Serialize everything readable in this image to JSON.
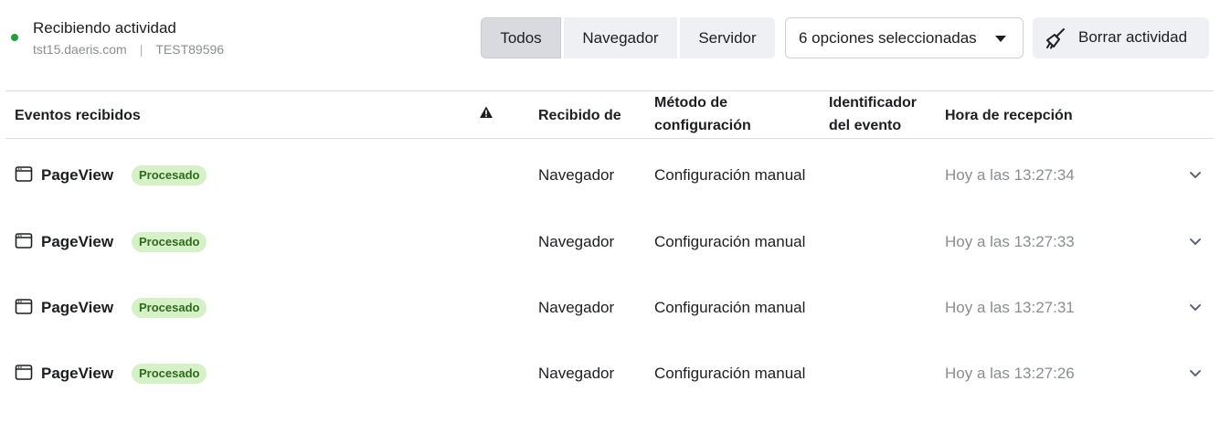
{
  "status": {
    "title": "Recibiendo actividad",
    "domain": "tst15.daeris.com",
    "separator": "|",
    "code": "TEST89596",
    "dot_color": "#22a03b"
  },
  "filters": {
    "segments": [
      {
        "label": "Todos",
        "selected": true
      },
      {
        "label": "Navegador",
        "selected": false
      },
      {
        "label": "Servidor",
        "selected": false
      }
    ],
    "options_dropdown": "6 opciones seleccionadas",
    "clear_button": "Borrar actividad"
  },
  "table": {
    "headers": {
      "events": "Eventos recibidos",
      "received_from": "Recibido de",
      "method_line1": "Método de",
      "method_line2": "configuración",
      "event_id_line1": "Identificador",
      "event_id_line2": "del evento",
      "received_time": "Hora de recepción"
    },
    "warning_icon": "warning-triangle-icon",
    "badge_color": "#d6f0c7",
    "rows": [
      {
        "event": "PageView",
        "status": "Procesado",
        "source": "Navegador",
        "method": "Configuración manual",
        "event_id": "",
        "time": "Hoy a las 13:27:34"
      },
      {
        "event": "PageView",
        "status": "Procesado",
        "source": "Navegador",
        "method": "Configuración manual",
        "event_id": "",
        "time": "Hoy a las 13:27:33"
      },
      {
        "event": "PageView",
        "status": "Procesado",
        "source": "Navegador",
        "method": "Configuración manual",
        "event_id": "",
        "time": "Hoy a las 13:27:31"
      },
      {
        "event": "PageView",
        "status": "Procesado",
        "source": "Navegador",
        "method": "Configuración manual",
        "event_id": "",
        "time": "Hoy a las 13:27:26"
      }
    ]
  }
}
